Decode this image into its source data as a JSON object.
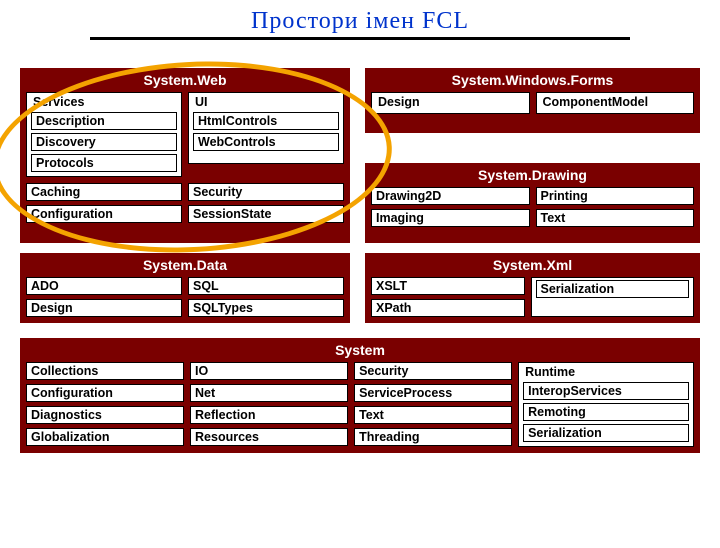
{
  "title": "Простори імен FCL",
  "panels": {
    "web": {
      "title": "System.Web",
      "services": {
        "title": "Services",
        "items": [
          "Description",
          "Discovery",
          "Protocols"
        ]
      },
      "ui": {
        "title": "UI",
        "items": [
          "HtmlControls",
          "WebControls"
        ]
      },
      "bottom": [
        "Caching",
        "Configuration",
        "Security",
        "SessionState"
      ]
    },
    "forms": {
      "title": "System.Windows.Forms",
      "items": [
        "Design",
        "ComponentModel"
      ]
    },
    "drawing": {
      "title": "System.Drawing",
      "items": [
        "Drawing2D",
        "Imaging",
        "Printing",
        "Text"
      ]
    },
    "data": {
      "title": "System.Data",
      "items": [
        "ADO",
        "Design",
        "SQL",
        "SQLTypes"
      ]
    },
    "xml": {
      "title": "System.Xml",
      "items": [
        "XSLT",
        "XPath",
        "Serialization"
      ]
    },
    "system": {
      "title": "System",
      "col1": [
        "Collections",
        "Configuration",
        "Diagnostics",
        "Globalization"
      ],
      "col2": [
        "IO",
        "Net",
        "Reflection",
        "Resources"
      ],
      "col3": [
        "Security",
        "ServiceProcess",
        "Text",
        "Threading"
      ],
      "runtime": {
        "title": "Runtime",
        "items": [
          "InteropServices",
          "Remoting",
          "Serialization"
        ]
      }
    }
  }
}
